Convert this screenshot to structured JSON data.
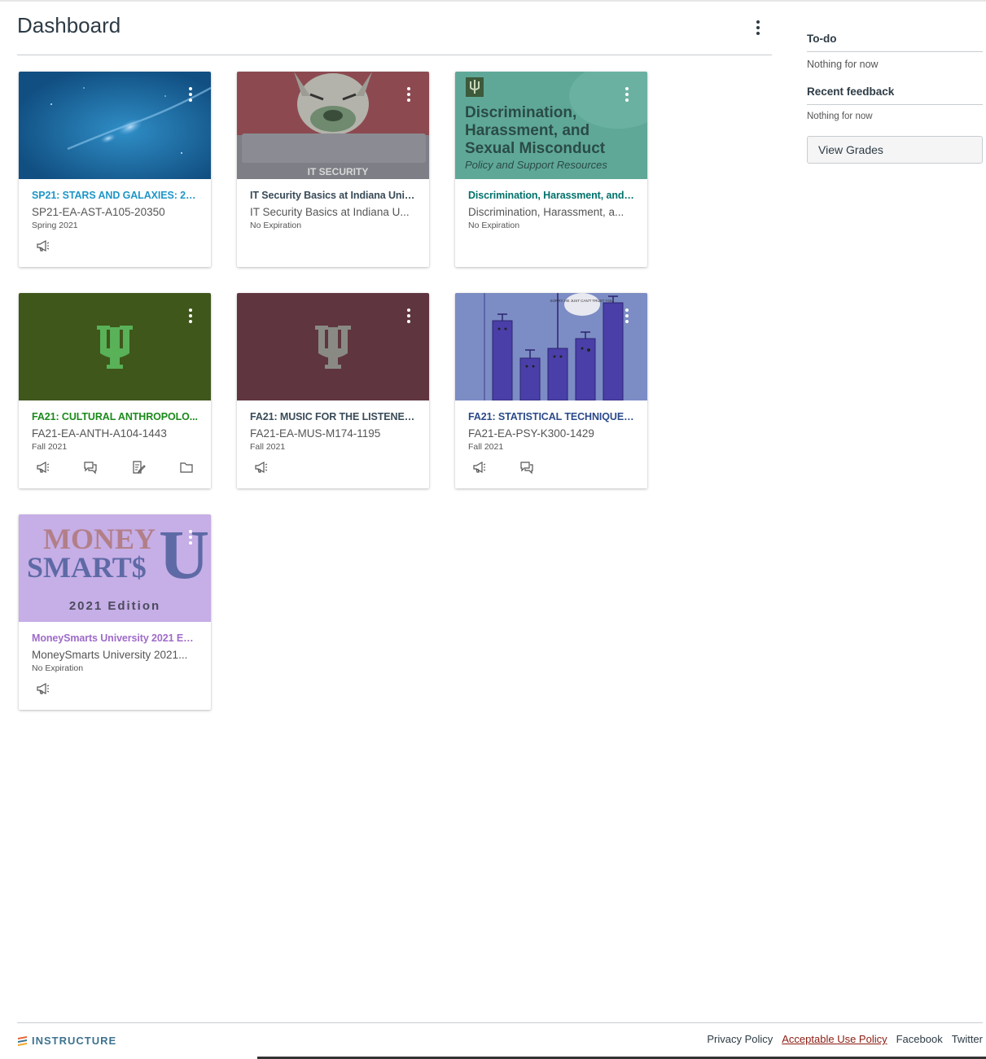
{
  "header": {
    "title": "Dashboard",
    "menu_icon": "kebab-icon"
  },
  "cards": [
    {
      "title": "SP21: STARS AND GALAXIES: 20...",
      "code": "SP21-EA-AST-A105-20350",
      "term": "Spring 2021",
      "title_color": "#1e96c8",
      "hero_color": "#1a6f9f",
      "actions": [
        "announcements-icon"
      ]
    },
    {
      "title": "IT Security Basics at Indiana Unive...",
      "code": "IT Security Basics at Indiana U...",
      "term": "No Expiration",
      "title_color": "#394b58",
      "hero_color": "#8c4a50",
      "hero_caption": "IT SECURITY",
      "actions": []
    },
    {
      "title": "Discrimination, Harassment, and S...",
      "code": "Discrimination, Harassment, a...",
      "term": "No Expiration",
      "title_color": "#00726b",
      "hero_color": "#5fa898",
      "hero_lines": [
        "Discrimination,",
        "Harassment, and",
        "Sexual Misconduct"
      ],
      "hero_sub": "Policy and Support Resources",
      "actions": []
    },
    {
      "title": "FA21: CULTURAL ANTHROPOLO...",
      "code": "FA21-EA-ANTH-A104-1443",
      "term": "Fall 2021",
      "title_color": "#1b8a1b",
      "hero_color": "#3f571b",
      "logo_color": "#59b158",
      "actions": [
        "announcements-icon",
        "discussions-icon",
        "assignments-icon",
        "files-icon"
      ]
    },
    {
      "title": "FA21: MUSIC FOR THE LISTENER...",
      "code": "FA21-EA-MUS-M174-1195",
      "term": "Fall 2021",
      "title_color": "#394b58",
      "hero_color": "#5f3540",
      "logo_color": "#8a8a85",
      "actions": [
        "announcements-icon"
      ]
    },
    {
      "title": "FA21: STATISTICAL TECHNIQUES...",
      "code": "FA21-EA-PSY-K300-1429",
      "term": "Fall 2021",
      "title_color": "#2b4a8a",
      "hero_color": "#7c8cc4",
      "hero_bubble": "SORRY. HE JUST CAN'T TRUST YOU.",
      "actions": [
        "announcements-icon",
        "discussions-icon"
      ]
    },
    {
      "title": "MoneySmarts University 2021 Edi...",
      "code": "MoneySmarts University 2021...",
      "term": "No Expiration",
      "title_color": "#9e6bc9",
      "hero_color": "#c6aee6",
      "hero_word1": "MONEY",
      "hero_word2": "SMART$",
      "hero_letter": "U",
      "hero_edition": "2021 Edition",
      "actions": [
        "announcements-icon"
      ]
    }
  ],
  "sidebar": {
    "todo_heading": "To-do",
    "todo_text": "Nothing for now",
    "feedback_heading": "Recent feedback",
    "feedback_text": "Nothing for now",
    "view_grades_label": "View Grades"
  },
  "footer": {
    "brand": "INSTRUCTURE",
    "links": [
      "Privacy Policy",
      "Acceptable Use Policy",
      "Facebook",
      "Twitter"
    ],
    "active_link": "Acceptable Use Policy"
  }
}
